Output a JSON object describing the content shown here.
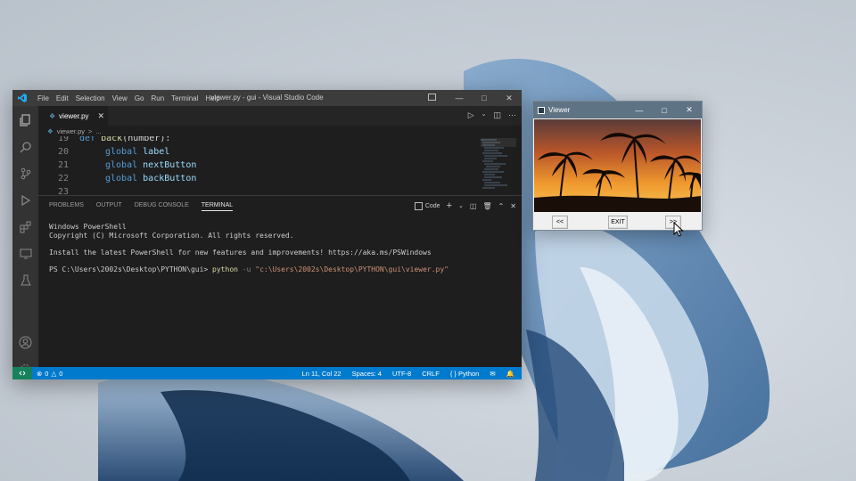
{
  "vscode": {
    "title": "viewer.py - gui - Visual Studio Code",
    "menu": [
      "File",
      "Edit",
      "Selection",
      "View",
      "Go",
      "Run",
      "Terminal",
      "Help"
    ],
    "tab_label": "viewer.py",
    "breadcrumb": [
      "viewer.py",
      ">",
      "..."
    ],
    "code_lines": [
      {
        "num": "19",
        "text": "def back(number):"
      },
      {
        "num": "20",
        "text": "global label"
      },
      {
        "num": "21",
        "text": "global nextButton"
      },
      {
        "num": "22",
        "text": "global backButton"
      },
      {
        "num": "23",
        "text": ""
      }
    ],
    "panel_tabs": [
      "PROBLEMS",
      "OUTPUT",
      "DEBUG CONSOLE",
      "TERMINAL"
    ],
    "terminal_profile": "Code",
    "terminal": {
      "line1": "Windows PowerShell",
      "line2": "Copyright (C) Microsoft Corporation. All rights reserved.",
      "line3": "Install the latest PowerShell for new features and improvements! https://aka.ms/PSWindows",
      "prompt": "PS C:\\Users\\2002s\\Desktop\\PYTHON\\gui>",
      "cmd": "python",
      "flag": "-u",
      "arg": "\"c:\\Users\\2002s\\Desktop\\PYTHON\\gui\\viewer.py\""
    },
    "status": {
      "problems": "0",
      "warnings": "0",
      "position": "Ln 11, Col 22",
      "spaces": "Spaces: 4",
      "encoding": "UTF-8",
      "eol": "CRLF",
      "language": "Python"
    }
  },
  "viewer": {
    "title": "Viewer",
    "back_label": "<<",
    "exit_label": "EXIT",
    "next_label": ">>"
  },
  "colors": {
    "statusbar": "#007acc",
    "editor_bg": "#1e1e1e",
    "viewer_titlebar": "#5e7384"
  }
}
